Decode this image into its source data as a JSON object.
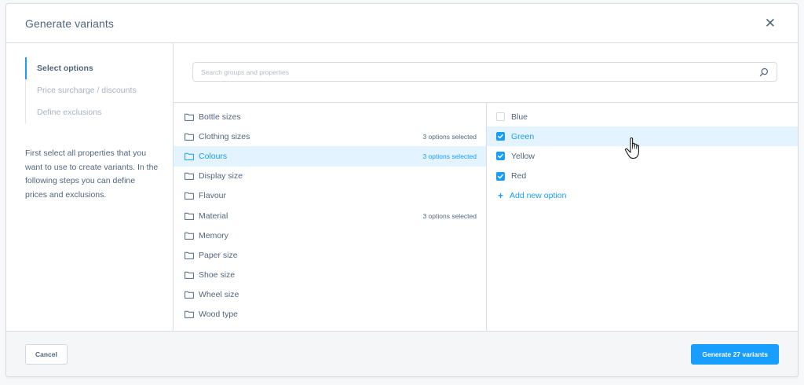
{
  "modal": {
    "title": "Generate variants"
  },
  "steps": [
    {
      "label": "Select options",
      "active": true
    },
    {
      "label": "Price surcharge / discounts",
      "active": false
    },
    {
      "label": "Define exclusions",
      "active": false
    }
  ],
  "help_text": "First select all properties that you want to use to create variants. In the following steps you can define prices and exclusions.",
  "search": {
    "placeholder": "Search groups and properties",
    "value": ""
  },
  "groups": [
    {
      "label": "Bottle sizes",
      "count": "",
      "active": false
    },
    {
      "label": "Clothing sizes",
      "count": "3 options selected",
      "active": false
    },
    {
      "label": "Colours",
      "count": "3 options selected",
      "active": true
    },
    {
      "label": "Display size",
      "count": "",
      "active": false
    },
    {
      "label": "Flavour",
      "count": "",
      "active": false
    },
    {
      "label": "Material",
      "count": "3 options selected",
      "active": false
    },
    {
      "label": "Memory",
      "count": "",
      "active": false
    },
    {
      "label": "Paper size",
      "count": "",
      "active": false
    },
    {
      "label": "Shoe size",
      "count": "",
      "active": false
    },
    {
      "label": "Wheel size",
      "count": "",
      "active": false
    },
    {
      "label": "Wood type",
      "count": "",
      "active": false
    }
  ],
  "options": [
    {
      "label": "Blue",
      "checked": false,
      "active": false
    },
    {
      "label": "Green",
      "checked": true,
      "active": true
    },
    {
      "label": "Yellow",
      "checked": true,
      "active": false
    },
    {
      "label": "Red",
      "checked": true,
      "active": false
    }
  ],
  "add_option_label": "Add new option",
  "footer": {
    "cancel_label": "Cancel",
    "generate_label": "Generate 27 variants"
  },
  "colors": {
    "accent": "#189eff",
    "text": "#52667a",
    "muted": "#a8b3bd",
    "border": "#d9dde1",
    "highlight": "#e3f3ff"
  },
  "icons": {
    "close": "close-icon",
    "search": "search-icon",
    "folder": "folder-icon",
    "check": "check-icon",
    "plus": "plus-icon",
    "cursor": "hand-pointer-icon"
  }
}
